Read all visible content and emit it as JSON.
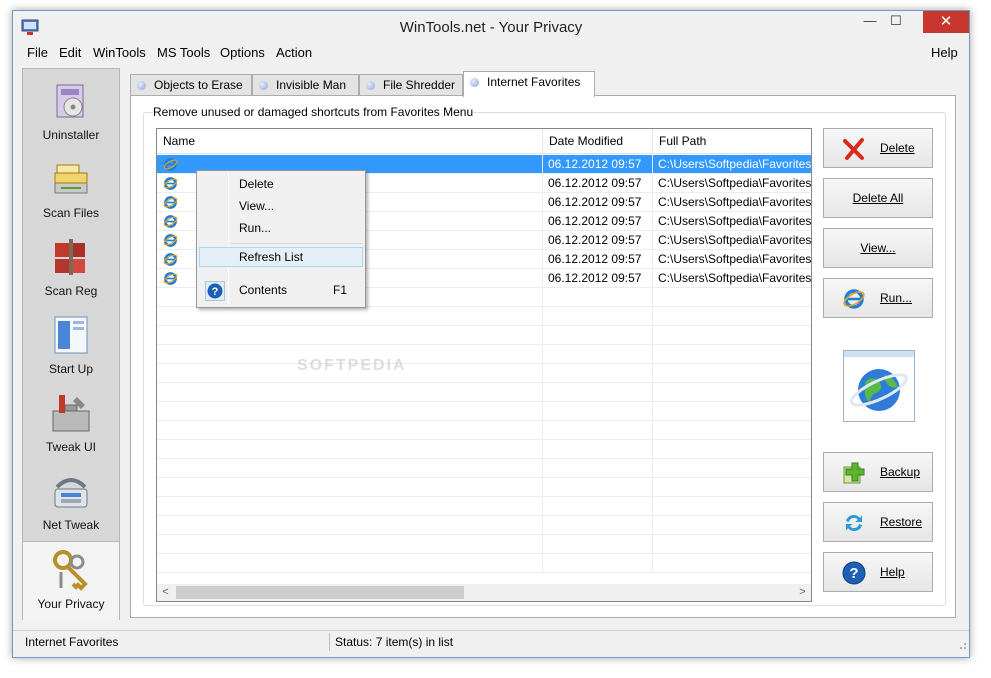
{
  "window": {
    "title": "WinTools.net - Your Privacy",
    "close_label": "✕",
    "minimize_label": "—",
    "maximize_label": "☐"
  },
  "menu": [
    "File",
    "Edit",
    "WinTools",
    "MS Tools",
    "Options",
    "Action"
  ],
  "menu_help": "Help",
  "sidebar": [
    {
      "label": "Uninstaller",
      "icon": "uninstaller-icon"
    },
    {
      "label": "Scan Files",
      "icon": "scan-files-icon"
    },
    {
      "label": "Scan Reg",
      "icon": "scan-reg-icon"
    },
    {
      "label": "Start Up",
      "icon": "start-up-icon"
    },
    {
      "label": "Tweak UI",
      "icon": "tweak-ui-icon"
    },
    {
      "label": "Net Tweak",
      "icon": "net-tweak-icon"
    },
    {
      "label": "Your Privacy",
      "icon": "your-privacy-icon",
      "active": true
    }
  ],
  "tabs": [
    "Objects to Erase",
    "Invisible Man",
    "File Shredder",
    "Internet Favorites"
  ],
  "active_tab": "Internet Favorites",
  "group_title": "Remove unused or damaged shortcuts from Favorites Menu",
  "list": {
    "columns": [
      "Name",
      "Date Modified",
      "Full Path"
    ],
    "rows": [
      {
        "date": "06.12.2012 09:57",
        "path": "C:\\Users\\Softpedia\\Favorites"
      },
      {
        "date": "06.12.2012 09:57",
        "path": "C:\\Users\\Softpedia\\Favorites"
      },
      {
        "date": "06.12.2012 09:57",
        "path": "C:\\Users\\Softpedia\\Favorites"
      },
      {
        "date": "06.12.2012 09:57",
        "path": "C:\\Users\\Softpedia\\Favorites"
      },
      {
        "date": "06.12.2012 09:57",
        "path": "C:\\Users\\Softpedia\\Favorites"
      },
      {
        "date": "06.12.2012 09:57",
        "path": "C:\\Users\\Softpedia\\Favorites"
      },
      {
        "date": "06.12.2012 09:57",
        "path": "C:\\Users\\Softpedia\\Favorites"
      }
    ],
    "scroll_left": "<",
    "scroll_right": ">"
  },
  "buttons": {
    "delete": "Delete",
    "delete_all": "Delete All",
    "view": "View...",
    "run": "Run...",
    "backup": "Backup",
    "restore": "Restore",
    "help": "Help"
  },
  "context_menu": {
    "items": [
      "Delete",
      "View...",
      "Run...",
      "Refresh List"
    ],
    "contents": "Contents",
    "contents_key": "F1"
  },
  "status": {
    "left": "Internet Favorites",
    "right": "Status: 7 item(s) in list"
  },
  "colors": {
    "selection": "#3399ff",
    "close": "#c7372f",
    "accent": "#6c9ac9"
  },
  "watermark": "SOFTPEDIA"
}
